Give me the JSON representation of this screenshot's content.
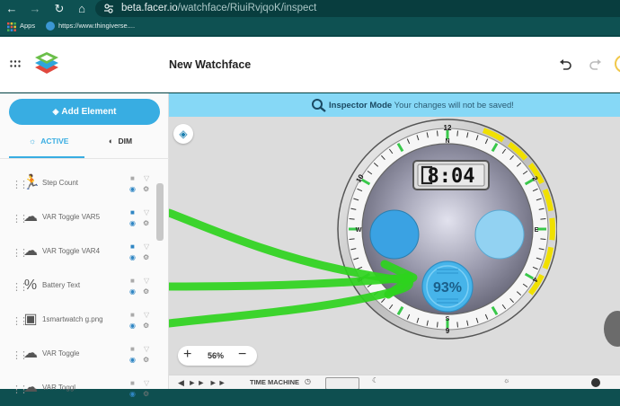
{
  "browser": {
    "url_host": "beta.facer.io",
    "url_path": "/watchface/RiuiRvjqoK/inspect",
    "bookmarks": [
      {
        "label": "Apps"
      },
      {
        "label": "https://www.thingiverse...."
      }
    ]
  },
  "header": {
    "title": "New Watchface"
  },
  "sidebar": {
    "add_label": "Add Element",
    "tabs": [
      {
        "label": "ACTIVE",
        "active": true
      },
      {
        "label": "DIM",
        "active": false
      }
    ],
    "layers": [
      {
        "label": "Step Count",
        "icon": "running-person-icon",
        "locked": false
      },
      {
        "label": "VAR Toggle VAR5",
        "icon": "cloud-gear-icon",
        "locked": true
      },
      {
        "label": "VAR Toggle VAR4",
        "icon": "cloud-gear-icon",
        "locked": true
      },
      {
        "label": "Battery Text",
        "icon": "percent-icon",
        "locked": false
      },
      {
        "label": "1smartwatch g.png",
        "icon": "image-icon",
        "locked": false
      },
      {
        "label": "VAR Toggle",
        "icon": "cloud-gear-icon",
        "locked": false
      },
      {
        "label": "VAR Toggl",
        "icon": "cloud-gear-icon",
        "locked": false
      }
    ]
  },
  "banner": {
    "mode": "Inspector Mode",
    "message": "Your changes will not be saved!"
  },
  "watch": {
    "time": "8:04",
    "battery": "93%",
    "dial_numbers": [
      "12",
      "2",
      "4",
      "6",
      "8",
      "10"
    ],
    "dial_letters": [
      "E",
      "S",
      "W",
      "N"
    ]
  },
  "zoom": {
    "level": "56%",
    "minus": "−",
    "plus": "+"
  },
  "bottom": {
    "time_machine": "TIME MACHINE"
  },
  "colors": {
    "accent": "#38ade2",
    "banner": "#86d8f6",
    "chrome": "#0e5152",
    "annotation_green": "#2ed21d",
    "left_circle": "#3aa2e3",
    "right_circle": "#92d2f2"
  }
}
